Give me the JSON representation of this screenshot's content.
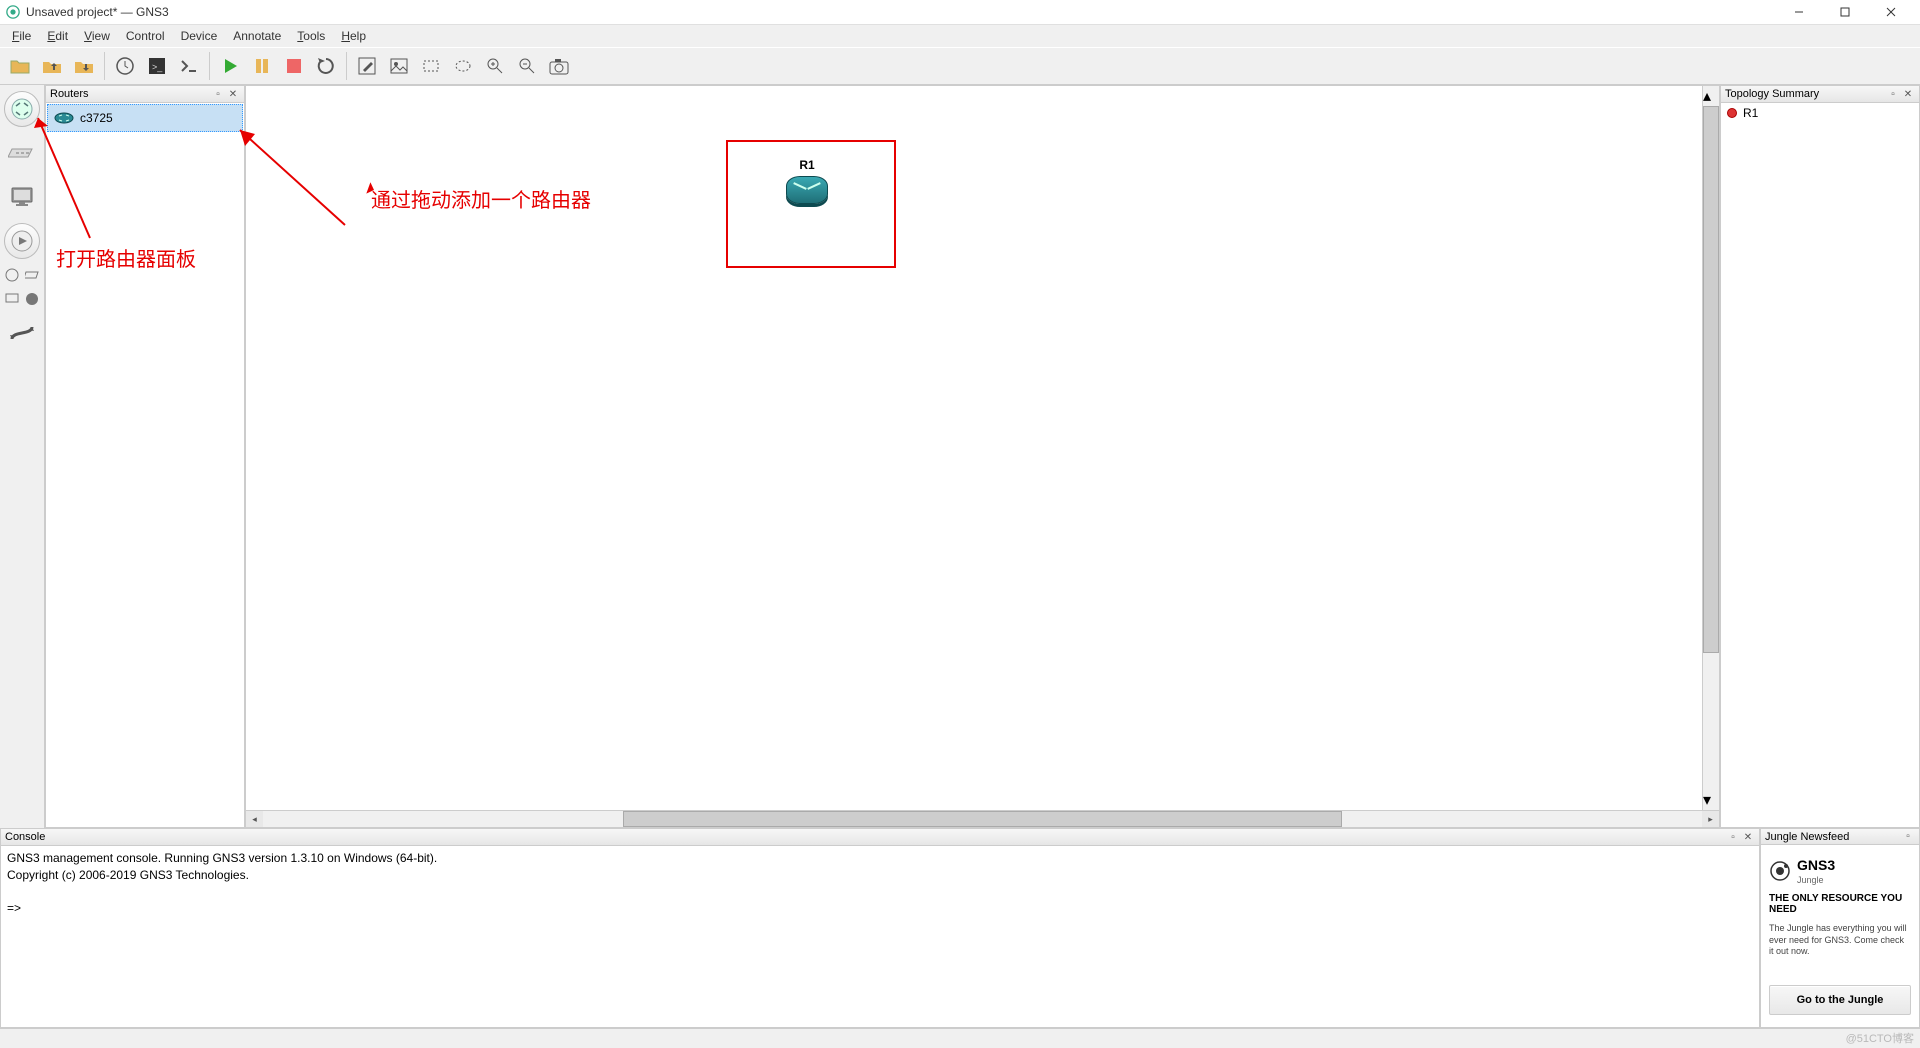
{
  "window": {
    "title": "Unsaved project* — GNS3"
  },
  "menu": [
    "File",
    "Edit",
    "View",
    "Control",
    "Device",
    "Annotate",
    "Tools",
    "Help"
  ],
  "panels": {
    "routers": {
      "title": "Routers",
      "items": [
        "c3725"
      ]
    },
    "topology": {
      "title": "Topology Summary",
      "items": [
        "R1"
      ]
    },
    "console": {
      "title": "Console",
      "line1": "GNS3 management console. Running GNS3 version 1.3.10 on Windows (64-bit).",
      "line2": "Copyright (c) 2006-2019 GNS3 Technologies.",
      "prompt": "=>"
    },
    "jungle": {
      "title": "Jungle Newsfeed",
      "brand": "GNS3",
      "brand_sub": "Jungle",
      "headline": "THE ONLY RESOURCE YOU NEED",
      "desc": "The Jungle has everything you will ever need for GNS3. Come check it out now.",
      "button": "Go to the Jungle"
    }
  },
  "canvas": {
    "node_label": "R1"
  },
  "annotations": {
    "a1": "通过拖动添加一个路由器",
    "a2": "打开路由器面板"
  },
  "watermark": "@51CTO博客"
}
